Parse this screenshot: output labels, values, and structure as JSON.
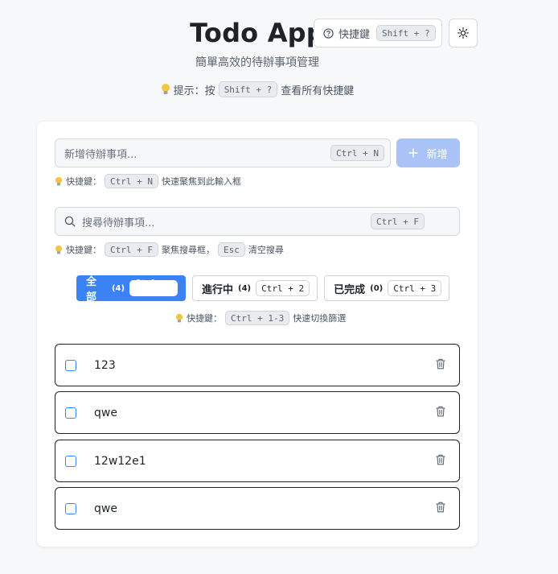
{
  "header": {
    "title": "Todo App",
    "subtitle": "簡單高效的待辦事項管理",
    "hint_prefix": "提示：按",
    "hint_key": "Shift + ?",
    "hint_suffix": "查看所有快捷鍵"
  },
  "toolbar": {
    "shortcut_label": "快捷鍵",
    "shortcut_key": "Shift + ?"
  },
  "new_todo": {
    "placeholder": "新增待辦事項...",
    "key": "Ctrl + N",
    "add_label": "新增",
    "hint_label": "快捷鍵：",
    "hint_key": "Ctrl + N",
    "hint_text": "快速聚焦到此輸入框"
  },
  "search": {
    "placeholder": "搜尋待辦事項...",
    "key": "Ctrl + F",
    "hint_label": "快捷鍵：",
    "hint_key1": "Ctrl + F",
    "hint_mid": "聚焦搜尋框，",
    "hint_key2": "Esc",
    "hint_text": "清空搜尋"
  },
  "filters": {
    "items": [
      {
        "label": "全部",
        "count": "(4)",
        "key": "Ctrl + 1"
      },
      {
        "label": "進行中",
        "count": "(4)",
        "key": "Ctrl + 2"
      },
      {
        "label": "已完成",
        "count": "(0)",
        "key": "Ctrl + 3"
      }
    ],
    "hint_label": "快捷鍵：",
    "hint_key": "Ctrl + 1-3",
    "hint_text": "快速切換篩選"
  },
  "todos": [
    {
      "text": "123",
      "done": false
    },
    {
      "text": "qwe",
      "done": false
    },
    {
      "text": "12w12e1",
      "done": false
    },
    {
      "text": "qwe",
      "done": false
    }
  ],
  "colors": {
    "accent": "#3b82f6",
    "add_button_disabled": "#a9c3f7",
    "background": "#f7f8fa"
  }
}
